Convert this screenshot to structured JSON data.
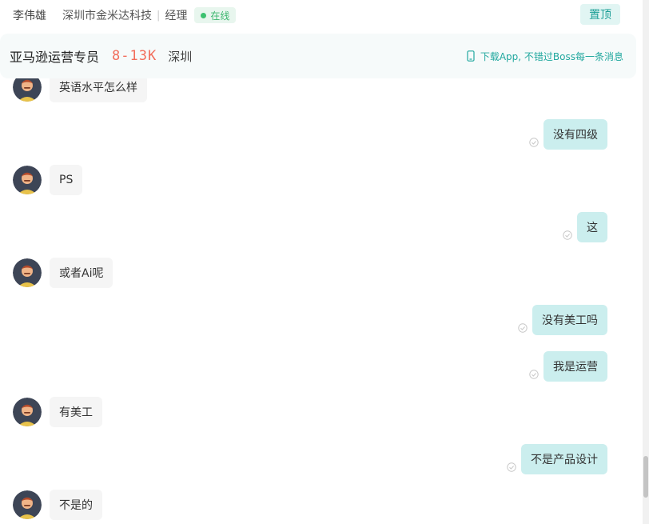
{
  "header": {
    "name": "李伟雄",
    "company": "深圳市金米达科技",
    "separator": "|",
    "role": "经理",
    "status": "在线",
    "pin_label": "置顶"
  },
  "job": {
    "title": "亚马逊运营专员",
    "salary": "8-13K",
    "city": "深圳",
    "app_promo": "下载App, 不错过Boss每一条消息"
  },
  "messages": [
    {
      "side": "left",
      "text": "英语水平怎么样"
    },
    {
      "side": "right",
      "text": "没有四级"
    },
    {
      "side": "left",
      "text": "PS"
    },
    {
      "side": "right",
      "text": "这"
    },
    {
      "side": "left",
      "text": "或者Ai呢"
    },
    {
      "side": "right",
      "text": "没有美工吗"
    },
    {
      "side": "right",
      "text": "我是运营"
    },
    {
      "side": "left",
      "text": "有美工"
    },
    {
      "side": "right",
      "text": "不是产品设计"
    },
    {
      "side": "left",
      "text": "不是的"
    }
  ],
  "colors": {
    "accent": "#1a9e96",
    "salary": "#f26d5b",
    "online": "#3cc16f",
    "bubble_out": "#cbeeee",
    "bubble_in": "#f5f5f5"
  }
}
